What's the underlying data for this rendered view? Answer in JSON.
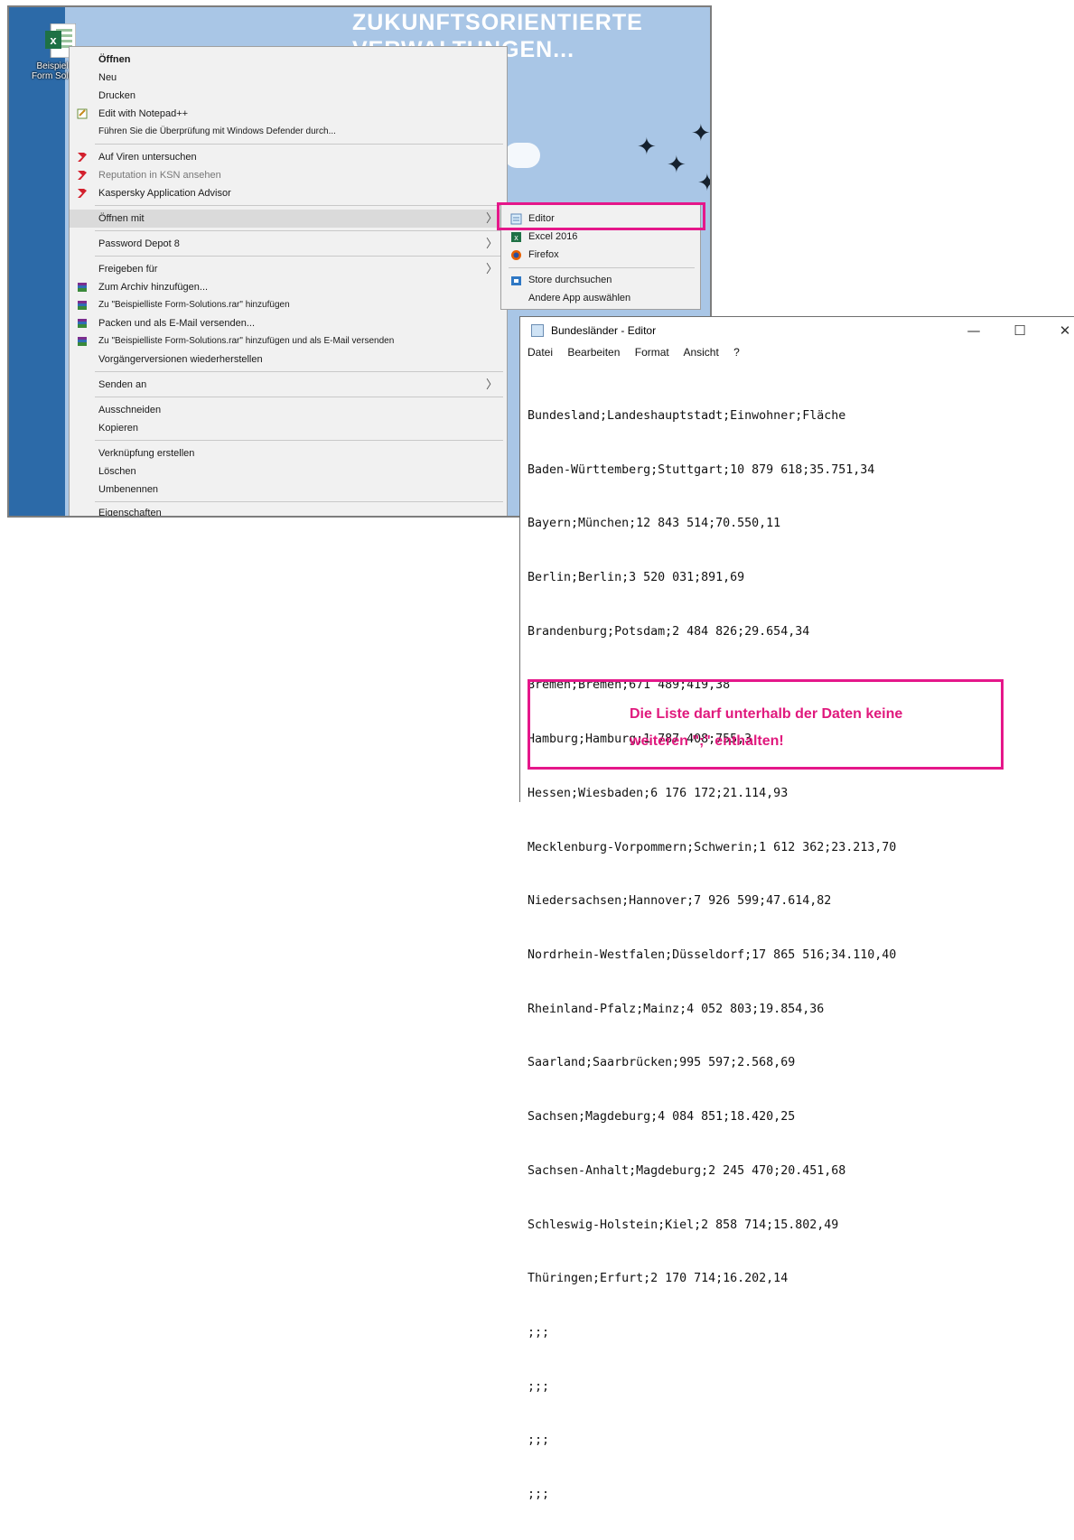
{
  "desktop": {
    "wallpaper_title_line1": "ZUKUNFTSORIENTIERTE",
    "wallpaper_title_line2": "VERWALTUNGEN...",
    "icon_label_line1": "Beispiel",
    "icon_label_line2": "Form Solu"
  },
  "context_menu": {
    "items": [
      {
        "label": "Öffnen"
      },
      {
        "label": "Neu"
      },
      {
        "label": "Drucken"
      },
      {
        "label": "Edit with Notepad++"
      },
      {
        "label": "Führen Sie die Überprüfung mit Windows Defender durch..."
      },
      {
        "label": "Auf Viren untersuchen"
      },
      {
        "label": "Reputation in KSN ansehen"
      },
      {
        "label": "Kaspersky Application Advisor"
      },
      {
        "label": "Öffnen mit"
      },
      {
        "label": "Password Depot 8"
      },
      {
        "label": "Freigeben für"
      },
      {
        "label": "Zum Archiv hinzufügen..."
      },
      {
        "label": "Zu \"Beispielliste Form-Solutions.rar\" hinzufügen"
      },
      {
        "label": "Packen und als E-Mail versenden..."
      },
      {
        "label": "Zu \"Beispielliste Form-Solutions.rar\" hinzufügen und als E-Mail versenden"
      },
      {
        "label": "Vorgängerversionen wiederherstellen"
      },
      {
        "label": "Senden an"
      },
      {
        "label": "Ausschneiden"
      },
      {
        "label": "Kopieren"
      },
      {
        "label": "Verknüpfung erstellen"
      },
      {
        "label": "Löschen"
      },
      {
        "label": "Umbenennen"
      },
      {
        "label": "Eigenschaften"
      }
    ]
  },
  "submenu": {
    "items": [
      {
        "label": "Editor"
      },
      {
        "label": "Excel 2016"
      },
      {
        "label": "Firefox"
      },
      {
        "label": "Store durchsuchen"
      },
      {
        "label": "Andere App auswählen"
      }
    ]
  },
  "notepad": {
    "title": "Bundesländer - Editor",
    "menu": [
      "Datei",
      "Bearbeiten",
      "Format",
      "Ansicht",
      "?"
    ],
    "lines": [
      "Bundesland;Landeshauptstadt;Einwohner;Fläche",
      "Baden-Württemberg;Stuttgart;10 879 618;35.751,34",
      "Bayern;München;12 843 514;70.550,11",
      "Berlin;Berlin;3 520 031;891,69",
      "Brandenburg;Potsdam;2 484 826;29.654,34",
      "Bremen;Bremen;671 489;419,38",
      "Hamburg;Hamburg;1 787 408;755,3",
      "Hessen;Wiesbaden;6 176 172;21.114,93",
      "Mecklenburg-Vorpommern;Schwerin;1 612 362;23.213,70",
      "Niedersachsen;Hannover;7 926 599;47.614,82",
      "Nordrhein-Westfalen;Düsseldorf;17 865 516;34.110,40",
      "Rheinland-Pfalz;Mainz;4 052 803;19.854,36",
      "Saarland;Saarbrücken;995 597;2.568,69",
      "Sachsen;Magdeburg;4 084 851;18.420,25",
      "Sachsen-Anhalt;Magdeburg;2 245 470;20.451,68",
      "Schleswig-Holstein;Kiel;2 858 714;15.802,49",
      "Thüringen;Erfurt;2 170 714;16.202,14",
      ";;;",
      ";;;",
      ";;;",
      ";;;"
    ],
    "window_buttons": {
      "minimize": "—",
      "maximize": "☐",
      "close": "✕"
    }
  },
  "annotation": {
    "line1": "Die Liste darf unterhalb der Daten keine",
    "line2": "weiteren \";\" enthalten!"
  },
  "colors": {
    "highlight": "#e5178a",
    "desktop_bg": "#a9c6e6",
    "menu_bg": "#f1f1f1"
  }
}
